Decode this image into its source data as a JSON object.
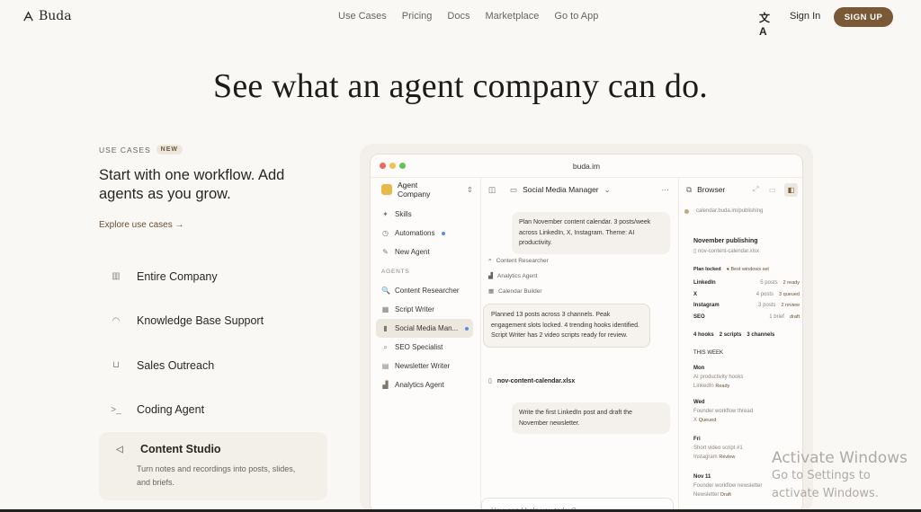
{
  "nav": {
    "logo": "Buda",
    "links": [
      "Use Cases",
      "Pricing",
      "Docs",
      "Marketplace",
      "Go to App"
    ],
    "sign_in": "Sign In",
    "sign_up": "SIGN UP"
  },
  "hero": {
    "title": "See what an agent company can do."
  },
  "use_cases": {
    "tag": "USE CASES",
    "badge": "NEW",
    "lead": "Start with one workflow. Add agents as you grow.",
    "explore": "Explore use cases →",
    "items": [
      {
        "label": "Entire Company",
        "icon": "building-icon"
      },
      {
        "label": "Knowledge Base Support",
        "icon": "headset-icon"
      },
      {
        "label": "Sales Outreach",
        "icon": "cart-icon"
      },
      {
        "label": "Coding Agent",
        "icon": "terminal-icon"
      },
      {
        "label": "Content Studio",
        "icon": "megaphone-icon",
        "desc": "Turn notes and recordings into posts, slides, and briefs."
      }
    ]
  },
  "app": {
    "window_title": "buda.im",
    "company": "Agent Company",
    "sidebar": {
      "top": [
        "Skills",
        "Automations",
        "New Agent"
      ],
      "agents_label": "AGENTS",
      "agents": [
        "Content Researcher",
        "Script Writer",
        "Social Media Man...",
        "SEO Specialist",
        "Newsletter Writer",
        "Analytics Agent"
      ]
    },
    "chat": {
      "title": "Social Media Manager",
      "msg1": "Plan November content calendar. 3 posts/week across LinkedIn, X, Instagram. Theme: AI productivity.",
      "steps": [
        "Content Researcher",
        "Analytics Agent",
        "Calendar Builder"
      ],
      "msg2": "Planned 13 posts across 3 channels. Peak engagement slots locked. 4 trending hooks identified. Script Writer has 2 video scripts ready for review.",
      "file": "nov-content-calendar.xlsx",
      "msg3": "Write the first LinkedIn post and draft the November newsletter.",
      "input_placeholder": "How can I help you today?"
    },
    "browser": {
      "title": "Browser",
      "url": "calendar.buda.im/publishing",
      "heading": "November publishing",
      "file": "nov-content-calendar.xlsx",
      "plan_locked": "Plan locked",
      "best_windows": "Best windows set",
      "rows": [
        {
          "ch": "LinkedIn",
          "count": "5 posts",
          "status": "2 ready"
        },
        {
          "ch": "X",
          "count": "4 posts",
          "status": "3 queued"
        },
        {
          "ch": "Instagram",
          "count": "3 posts",
          "status": "2 review"
        },
        {
          "ch": "SEO",
          "count": "1 brief",
          "status": "draft"
        }
      ],
      "summary": [
        "4 hooks",
        "2 scripts",
        "3 channels"
      ],
      "this_week": "THIS WEEK",
      "days": [
        {
          "day": "Mon",
          "item": "AI productivity hooks",
          "ch": "LinkedIn",
          "st": "Ready"
        },
        {
          "day": "Wed",
          "item": "Founder workflow thread",
          "ch": "X",
          "st": "Queued"
        },
        {
          "day": "Fri",
          "item": "Short video script #1",
          "ch": "Instagram",
          "st": "Review"
        },
        {
          "day": "Nov 11",
          "item": "Founder workflow newsletter",
          "ch": "Newsletter",
          "st": "Draft"
        }
      ]
    }
  },
  "watermark": {
    "line1": "Activate Windows",
    "line2": "Go to Settings to activate Windows."
  },
  "colors": {
    "accent": "#7a5a36",
    "background": "#faf8f5"
  }
}
